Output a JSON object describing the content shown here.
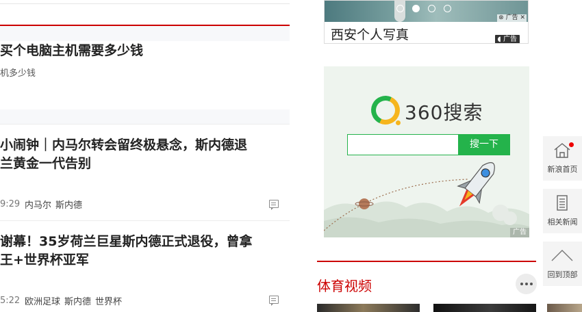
{
  "news": [
    {
      "title": "买个电脑主机需要多少钱",
      "subtitle": "机多少钱"
    },
    {
      "title_line1": "小闹钟｜内马尔转会留终极悬念，斯内德退",
      "title_line2": "兰黄金一代告别",
      "time": "9:29",
      "tags": [
        "内马尔",
        "斯内德"
      ]
    },
    {
      "title_line1": "谢幕！35岁荷兰巨星斯内德正式退役，曾拿",
      "title_line2": "王+世界杯亚军",
      "time": "5:22",
      "tags": [
        "欧洲足球",
        "斯内德",
        "世界杯"
      ]
    }
  ],
  "ad_top": {
    "text": "西安个人写真",
    "photo_badge": "广告",
    "tag": "广告"
  },
  "ad_360": {
    "logo_text": "360搜索",
    "search_button": "搜一下",
    "search_value": "",
    "badge": "广告",
    "brand_green": "#24b34b",
    "brand_yellow": "#f6b51d"
  },
  "sports": {
    "title": "体育视频"
  },
  "side_toolbar": {
    "home": "新浪首页",
    "related": "相关新闻",
    "top": "回到顶部"
  },
  "colors": {
    "accent_red": "#cc0000"
  }
}
